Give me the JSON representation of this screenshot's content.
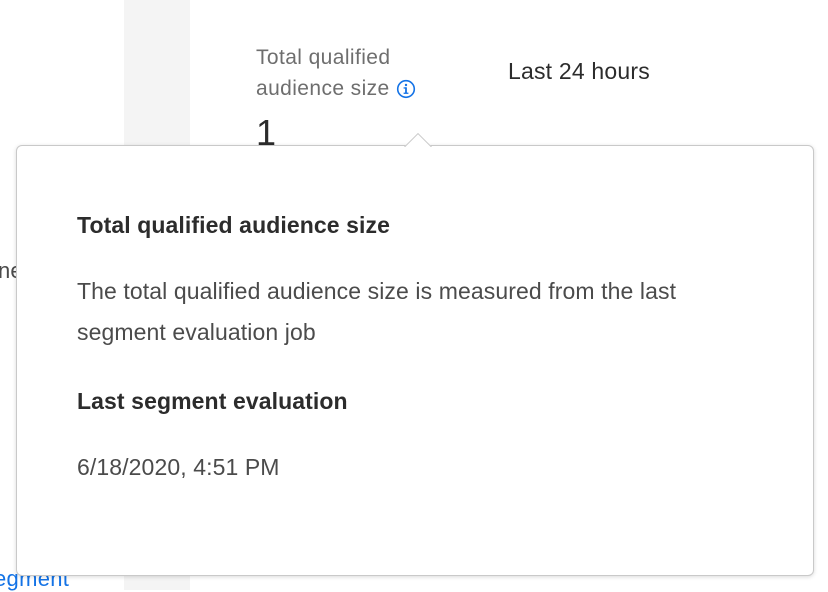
{
  "background": {
    "left_text_fragment": "ne",
    "left_link_fragment": "egment"
  },
  "metric": {
    "label_line1": "Total qualified",
    "label_line2": "audience size",
    "value": "1",
    "time_range": "Last 24 hours",
    "info_icon": "info-icon"
  },
  "popover": {
    "title": "Total qualified audience size",
    "description": "The total qualified audience size is measured from the last segment evaluation job",
    "subtitle": "Last segment evaluation",
    "timestamp": "6/18/2020, 4:51 PM"
  },
  "colors": {
    "accent": "#1473e6",
    "text_primary": "#2c2c2c",
    "text_secondary": "#6e6e6e",
    "rail": "#f4f4f4",
    "border": "#c9c9c9"
  }
}
